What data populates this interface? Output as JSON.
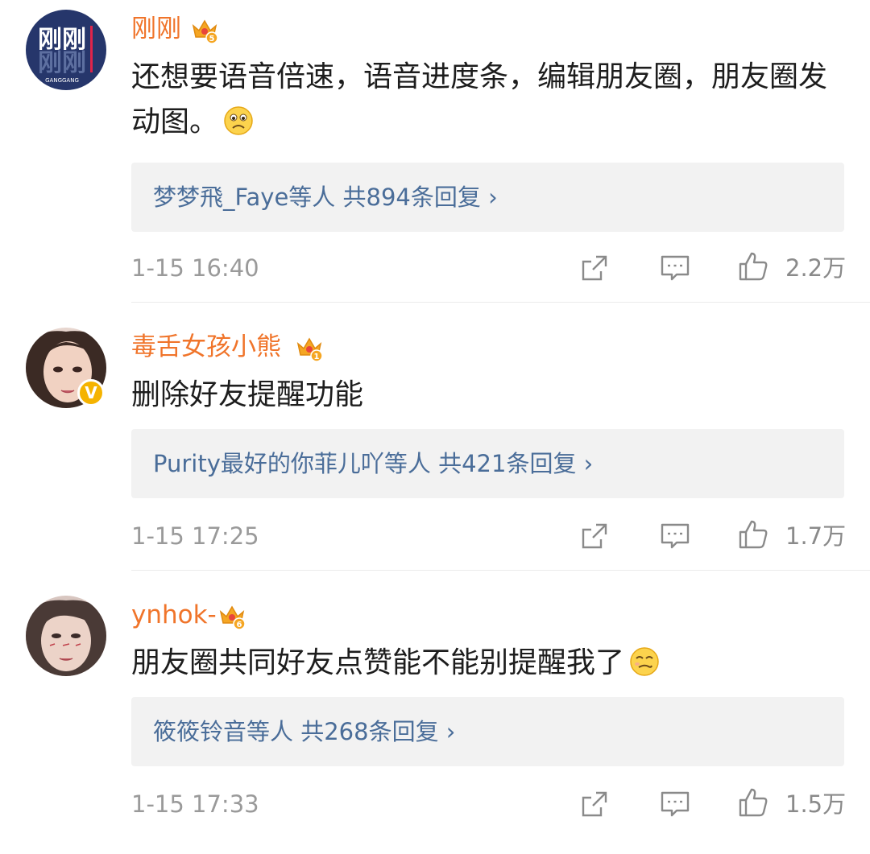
{
  "comments": [
    {
      "username": "刚刚",
      "avatar": {
        "text_top": "刚刚",
        "text_bottom": "刚刚",
        "caption": "GANGGANG",
        "bg": "#26366b"
      },
      "crown_level": "5",
      "text": "还想要语音倍速，语音进度条，编辑朋友圈，朋友圈发动图。",
      "emoji": "sad-face-emoji",
      "reply_summary": "梦梦飛_Faye等人 共894条回复 ›",
      "time": "1-15 16:40",
      "likes": "2.2万",
      "verified": false
    },
    {
      "username": "毒舌女孩小熊",
      "avatar": {
        "bg": "#d9b8a8"
      },
      "crown_level": "1",
      "text": "删除好友提醒功能",
      "emoji": "",
      "reply_summary": "Purity最好的你菲儿吖等人 共421条回复 ›",
      "time": "1-15 17:25",
      "likes": "1.7万",
      "verified": true,
      "verified_mark": "V"
    },
    {
      "username": "ynhok-",
      "avatar": {
        "bg": "#d8c6c0"
      },
      "crown_level": "6",
      "text": "朋友圈共同好友点赞能不能别提醒我了",
      "emoji": "smirk-face-emoji",
      "reply_summary": "筱筱铃音等人 共268条回复 ›",
      "time": "1-15 17:33",
      "likes": "1.5万",
      "verified": false
    }
  ],
  "colors": {
    "username": "#f0742a",
    "link": "#4a6d99",
    "meta": "#9a9a9a",
    "crown": "#f5a623"
  },
  "icons": {
    "share": "share-icon",
    "comment": "comment-icon",
    "like": "thumbs-up-icon",
    "crown": "crown-badge-icon"
  }
}
